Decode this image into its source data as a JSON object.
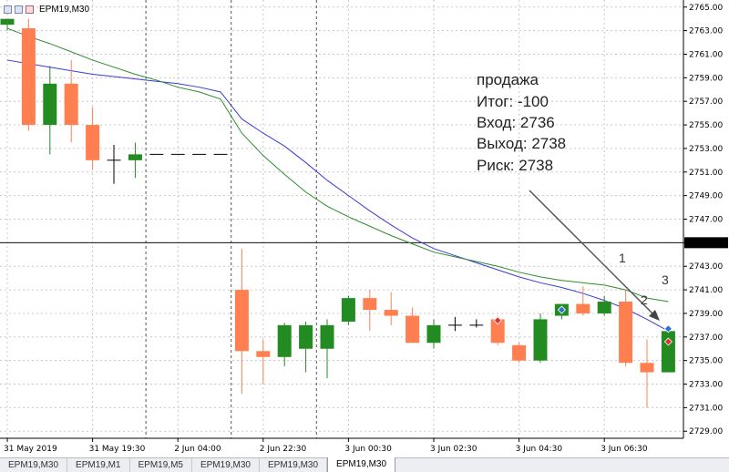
{
  "window": {
    "title": "EPM19,M30"
  },
  "tabs": [
    {
      "label": "EPM19,M30",
      "active": false
    },
    {
      "label": "EPM19,M1",
      "active": false
    },
    {
      "label": "EPM19,M5",
      "active": false
    },
    {
      "label": "EPM19,M30",
      "active": false
    },
    {
      "label": "EPM19,M30",
      "active": false
    },
    {
      "label": "EPM19,M30",
      "active": true
    }
  ],
  "annotation": {
    "lines": [
      "продажа",
      "Итог: -100",
      "Вход: 2736",
      "Выход: 2738",
      "Риск: 2738"
    ],
    "markers": [
      "1",
      "2",
      "3"
    ]
  },
  "colors": {
    "bull": "#228b22",
    "bear": "#ff7f50",
    "ma_blue": "#3a3ad6",
    "ma_green": "#2e8b2e"
  },
  "chart_data": {
    "type": "candlestick",
    "ylim": [
      2728.4,
      2765.6
    ],
    "y_ticks": [
      2729,
      2731,
      2733,
      2735,
      2737,
      2739,
      2741,
      2743,
      2745,
      2747,
      2749,
      2751,
      2753,
      2755,
      2757,
      2759,
      2761,
      2763,
      2765
    ],
    "y_tick_labels": [
      "2729.00",
      "2731.00",
      "2733.00",
      "2735.00",
      "2737.00",
      "2739.00",
      "2741.00",
      "2743.00",
      "2745.00",
      "2747.00",
      "2749.00",
      "2751.00",
      "2753.00",
      "2755.00",
      "2757.00",
      "2759.00",
      "2761.00",
      "2763.00",
      "2765.00"
    ],
    "current_price": 2745.0,
    "current_price_label": "2745.00",
    "x_labels": [
      "31 May 2019",
      "31 May 19:30",
      "2 Jun 04:00",
      "2 Jun 22:30",
      "3 Jun 00:30",
      "3 Jun 02:30",
      "3 Jun 04:30",
      "3 Jun 06:30"
    ],
    "x_label_index": [
      0,
      4,
      8,
      12,
      16,
      20,
      24,
      28
    ],
    "session_breaks": [
      7,
      11,
      15
    ],
    "candles": [
      {
        "o": 2763.5,
        "h": 2763.8,
        "l": 2763.0,
        "c": 2764.0
      },
      {
        "o": 2763.2,
        "h": 2764.0,
        "l": 2754.5,
        "c": 2755.0
      },
      {
        "o": 2755.0,
        "h": 2760.0,
        "l": 2752.5,
        "c": 2758.5
      },
      {
        "o": 2758.5,
        "h": 2760.5,
        "l": 2753.5,
        "c": 2755.0
      },
      {
        "o": 2755.0,
        "h": 2756.5,
        "l": 2751.2,
        "c": 2752.0
      },
      {
        "o": 2752.0,
        "h": 2753.3,
        "l": 2750.0,
        "c": 2752.0
      },
      {
        "o": 2752.0,
        "h": 2753.5,
        "l": 2750.5,
        "c": 2752.5
      },
      {
        "o": 2752.5,
        "h": 2752.5,
        "l": 2752.5,
        "c": 2752.5
      },
      {
        "o": 2752.5,
        "h": 2752.5,
        "l": 2752.5,
        "c": 2752.5
      },
      {
        "o": 2752.5,
        "h": 2752.5,
        "l": 2752.5,
        "c": 2752.5
      },
      {
        "o": 2752.5,
        "h": 2752.5,
        "l": 2752.5,
        "c": 2752.5
      },
      {
        "o": 2741.0,
        "h": 2744.5,
        "l": 2732.2,
        "c": 2735.8
      },
      {
        "o": 2735.8,
        "h": 2736.8,
        "l": 2733.0,
        "c": 2735.3
      },
      {
        "o": 2735.3,
        "h": 2738.2,
        "l": 2734.5,
        "c": 2738.0
      },
      {
        "o": 2736.0,
        "h": 2738.3,
        "l": 2734.0,
        "c": 2738.0
      },
      {
        "o": 2736.0,
        "h": 2738.5,
        "l": 2733.5,
        "c": 2738.0
      },
      {
        "o": 2738.3,
        "h": 2740.5,
        "l": 2738.0,
        "c": 2740.3
      },
      {
        "o": 2740.3,
        "h": 2741.0,
        "l": 2737.5,
        "c": 2739.3
      },
      {
        "o": 2739.3,
        "h": 2740.8,
        "l": 2738.0,
        "c": 2738.8
      },
      {
        "o": 2738.8,
        "h": 2739.5,
        "l": 2736.5,
        "c": 2736.5
      },
      {
        "o": 2736.5,
        "h": 2738.5,
        "l": 2736.0,
        "c": 2738.0
      },
      {
        "o": 2738.0,
        "h": 2738.7,
        "l": 2737.5,
        "c": 2738.0
      },
      {
        "o": 2738.0,
        "h": 2738.5,
        "l": 2737.8,
        "c": 2738.0
      },
      {
        "o": 2738.5,
        "h": 2738.8,
        "l": 2736.3,
        "c": 2736.5
      },
      {
        "o": 2736.3,
        "h": 2736.5,
        "l": 2734.8,
        "c": 2735.0
      },
      {
        "o": 2735.0,
        "h": 2739.0,
        "l": 2734.8,
        "c": 2738.5
      },
      {
        "o": 2738.8,
        "h": 2739.8,
        "l": 2738.5,
        "c": 2739.8
      },
      {
        "o": 2739.8,
        "h": 2741.3,
        "l": 2738.8,
        "c": 2739.0
      },
      {
        "o": 2739.0,
        "h": 2740.5,
        "l": 2738.8,
        "c": 2740.0
      },
      {
        "o": 2740.0,
        "h": 2741.0,
        "l": 2734.5,
        "c": 2734.8
      },
      {
        "o": 2734.8,
        "h": 2736.8,
        "l": 2731.0,
        "c": 2734.0
      },
      {
        "o": 2734.0,
        "h": 2738.0,
        "l": 2734.0,
        "c": 2737.5
      }
    ],
    "series": [
      {
        "color": "#3a3ad6",
        "values": [
          2760.5,
          2760.2,
          2759.9,
          2759.6,
          2759.3,
          2759.1,
          2758.9,
          2758.7,
          2758.5,
          2758.2,
          2757.8,
          2755.5,
          2754.3,
          2753.2,
          2751.8,
          2750.3,
          2749.0,
          2747.7,
          2746.5,
          2745.4,
          2744.5,
          2743.9,
          2743.3,
          2742.7,
          2742.1,
          2741.6,
          2741.2,
          2740.7,
          2740.1,
          2739.4,
          2738.5,
          2737.5
        ]
      },
      {
        "color": "#2e8b2e",
        "values": [
          2763.2,
          2762.5,
          2761.9,
          2761.2,
          2760.5,
          2759.9,
          2759.3,
          2758.8,
          2758.2,
          2757.8,
          2757.2,
          2754.3,
          2752.4,
          2750.8,
          2749.3,
          2748.1,
          2747.2,
          2746.4,
          2745.6,
          2744.9,
          2744.2,
          2743.8,
          2743.4,
          2743.0,
          2742.5,
          2742.1,
          2741.8,
          2741.6,
          2741.4,
          2741.0,
          2740.3,
          2740.0
        ]
      }
    ],
    "trade_markers": [
      {
        "i": 23,
        "price": 2738.4,
        "kind": "sell"
      },
      {
        "i": 26,
        "price": 2739.3,
        "kind": "buy"
      },
      {
        "i": 31,
        "price": 2737.7,
        "kind": "buy"
      },
      {
        "i": 31,
        "price": 2736.6,
        "kind": "sell"
      }
    ]
  }
}
